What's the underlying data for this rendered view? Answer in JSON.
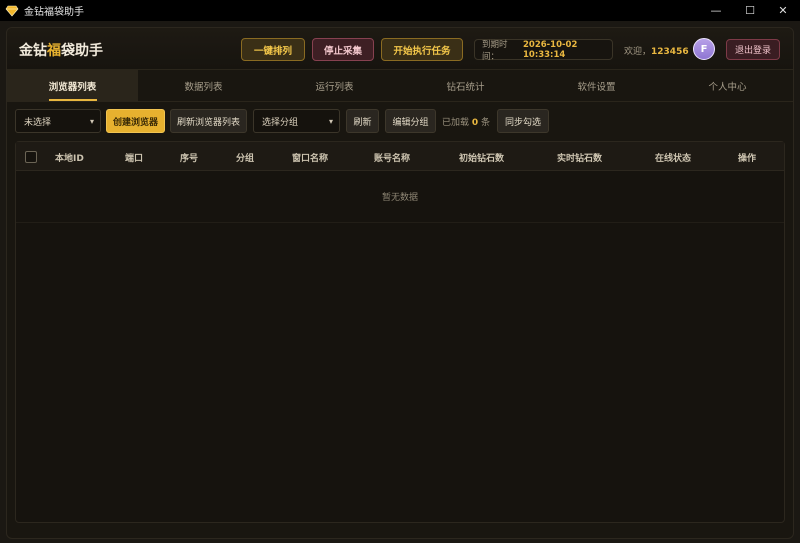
{
  "window": {
    "title": "金钻福袋助手",
    "controls": {
      "minimize": "—",
      "maximize": "☐",
      "close": "✕"
    }
  },
  "header": {
    "brand_prefix": "金钻",
    "brand_accent": "福",
    "brand_suffix": "袋助手",
    "buttons": {
      "arrange": "一键排列",
      "stop": "停止采集",
      "start": "开始执行任务"
    },
    "expire_label": "到期时间：",
    "expire_value": "2026-10-02 10:33:14",
    "welcome_label": "欢迎，",
    "username": "123456",
    "avatar_letter": "F",
    "logout": "退出登录"
  },
  "tabs": [
    {
      "label": "浏览器列表",
      "active": true
    },
    {
      "label": "数据列表",
      "active": false
    },
    {
      "label": "运行列表",
      "active": false
    },
    {
      "label": "钻石统计",
      "active": false
    },
    {
      "label": "软件设置",
      "active": false
    },
    {
      "label": "个人中心",
      "active": false
    }
  ],
  "toolbar": {
    "filter_select": "未选择",
    "create_browser": "创建浏览器",
    "refresh_browser_list": "刷新浏览器列表",
    "group_select": "选择分组",
    "refresh": "刷新",
    "edit_group": "编辑分组",
    "loaded_prefix": "已加载",
    "loaded_count": "0",
    "loaded_suffix": "条",
    "sync_check": "同步勾选"
  },
  "table": {
    "columns": [
      "本地ID",
      "端口",
      "序号",
      "分组",
      "窗口名称",
      "账号名称",
      "初始钻石数",
      "实时钻石数",
      "在线状态",
      "操作"
    ],
    "empty_text": "暂无数据"
  },
  "colors": {
    "accent": "#e9b740",
    "background": "#1b1813",
    "danger": "#874150"
  }
}
